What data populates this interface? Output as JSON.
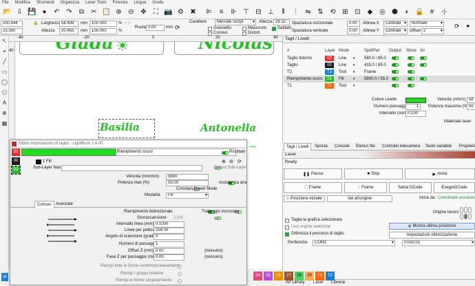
{
  "menu": [
    "File",
    "Modifica",
    "Strumenti",
    "Organizza",
    "Laser Tools",
    "Finestra",
    "Lingua",
    "Guida"
  ],
  "options": {
    "x": "200.644",
    "y": "23.350",
    "larghezza_label": "Larghezza",
    "larghezza": "58.499",
    "altezza_label": "Altezza",
    "altezza": "20.455",
    "unit": "mm",
    "scale_w": "100.000",
    "scale_h": "100.000",
    "percent": "%",
    "rotate_label": "Ruota",
    "rotate": "0.00",
    "rotate_unit": "mm",
    "carattere_label": "Carattere",
    "font": "Mervale Script",
    "grassetto": "Grassetto",
    "corsivo": "Corsivo",
    "maiuscolo": "Maiuscolo",
    "distort": "Distort",
    "saldato": "Saldato",
    "altezza_text_label": "Altezza",
    "altezza_text": "26.32",
    "spaz_h_label": "Spaziatura orizzontale",
    "spaz_h": "0.00",
    "spaz_v_label": "Spaziatura verticale",
    "spaz_v": "0.00",
    "allinea_x_label": "Allinea X",
    "allinea_x": "Centrale",
    "allinea_y_label": "Allinea Y",
    "allinea_y": "Centrale",
    "normale": "Normale",
    "offset_label": "Offset",
    "offset": "2"
  },
  "ruler": {
    "ticks": [
      "-40",
      "-20",
      "0",
      "20",
      "40"
    ],
    "left_tick": "40"
  },
  "canvas": {
    "names": [
      "Giada",
      "Nicolas",
      "Basilia",
      "Antonella"
    ]
  },
  "layers": {
    "title": "Tagli / Livelli",
    "headers": [
      "#",
      "Layer",
      "Mode",
      "Spd/Pwr",
      "Output",
      "Show",
      "Air"
    ],
    "rows": [
      {
        "name": "Taglio Interno",
        "layer": "02",
        "color": "#e03131",
        "mode": "Line",
        "spd": "580.0 / 85.0"
      },
      {
        "name": "Taglio",
        "layer": "00",
        "color": "#1a1a1a",
        "mode": "Line",
        "spd": "415.0 / 85.0"
      },
      {
        "name": "T2",
        "layer": "T2",
        "color": "#1c7ed6",
        "mode": "Tool",
        "spd": "Frame"
      },
      {
        "name": "Riempimento scuro",
        "layer": "03",
        "color": "#2fb82f",
        "mode": "Fill",
        "spd": "5800.0 / 55.0"
      },
      {
        "name": "T1",
        "layer": "T1",
        "color": "#f76707",
        "mode": "Tool",
        "spd": ""
      }
    ],
    "colore_livello": "Colore Livello",
    "velocita_label": "Velocità (mm/s)",
    "velocita": "58",
    "passaggi_label": "Numero passaggi",
    "passaggi": "1",
    "potenza_label": "Potenza massima (%)",
    "potenza": "55",
    "intervallo_label": "Intervallo (mm)",
    "intervallo": "0.100",
    "materiale": "Materiale laser",
    "layer_color": "#22dd22"
  },
  "tabs_right": [
    "Tagli / Livelli",
    "Sposta",
    "Console",
    "Elenco file",
    "Controllo telecamera",
    "Testo variabile",
    "Proprietà"
  ],
  "laser": {
    "title": "Laser",
    "status": "Ready",
    "pausa": "Pausa",
    "stop": "Stop",
    "avvia": "Avvia",
    "frame": "Frame",
    "frame2": "Frame",
    "salva": "Salva GCode",
    "esegui": "EseguiGCode",
    "pos_iniziale": "Posizione iniziale",
    "origine": "Vai all'origine",
    "inizia_da_label": "Inizia da:",
    "inizia_da": "Coordinate assolute",
    "origine_lavoro": "Origine lavoro",
    "taglia": "Taglia la grafica selezionata",
    "usa_origine": "Usa origine selezione",
    "mostra": "Mostra ultima posizione",
    "ottimizza": "Ottimizza il percorso di taglio",
    "impostazioni": "Impostazioni ottimizzazione",
    "periferiche_label": "Periferiche",
    "port": "COM1",
    "device": "xTool-S1"
  },
  "bottom_tabs": [
    "Art Library",
    "Laser",
    "Libreria"
  ],
  "dialog": {
    "title": "Editor impostazioni di taglio - LightBurn 1.4.00",
    "layers": [
      "02",
      "00",
      "03"
    ],
    "layer_colors": [
      "#e03131",
      "#1a1a1a",
      "#2fb82f"
    ],
    "name": "Riempimento scuro",
    "risultato": "Risultato",
    "fill_label": "1 Fill",
    "sublayer_label": "Sub-Layer Name",
    "output_sublayer": "Output Sub-Layer",
    "velocita_label": "Velocità (mm/min)",
    "velocita": "5800",
    "potenza_label": "Potenza max (%)",
    "potenza": "55.00",
    "assistenza": "Assistenza aria",
    "constant": "Constant Power Mode",
    "modalita_label": "Modalità",
    "modalita": "Fill",
    "tabs": [
      "Comuni",
      "Avanzate"
    ],
    "bidirezionale": "Riempimento bidirezionale",
    "incrociato": "Tratteggio incrociato",
    "sovrascansione_label": "Sovrascansione",
    "sovrascansione": "2.5%",
    "intervallo_label": "Intervallo linea (mm)",
    "intervallo": "0.1000",
    "linee_label": "Linee per pollice",
    "linee": "254.00",
    "angolo_label": "Angolo di scansione (gradi)",
    "angolo": "0",
    "passaggi_label": "Numero di passaggi",
    "passaggi": "1",
    "offset_label": "Offset Z (mm)",
    "offset": "0.00",
    "fase_label": "Fase Z per passaggio (mm)",
    "fase": "0.00",
    "nessuno": "(nessuno)",
    "opt1": "Riempi tutte le forme contemporaneamente",
    "opt2": "Riempi i gruppi insieme",
    "opt3": "Riempi le forme singolarmente"
  },
  "palette": [
    {
      "n": "24",
      "c": "#e64980"
    },
    {
      "n": "25",
      "c": "#be4bdb"
    },
    {
      "n": "26",
      "c": "#f08c00"
    },
    {
      "n": "27",
      "c": "#a0522d"
    },
    {
      "n": "28",
      "c": "#51cf66"
    },
    {
      "n": "29",
      "c": "#ffa94d"
    },
    {
      "n": "T1",
      "c": "#f76707"
    },
    {
      "n": "T2",
      "c": "#1c7ed6"
    }
  ],
  "status_left": "0S"
}
